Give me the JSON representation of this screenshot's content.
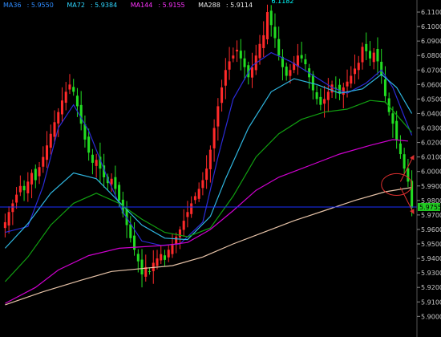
{
  "colors": {
    "background": "#000000",
    "up": "#ff2a2a",
    "down": "#22dd22",
    "ma36": "#2b2bd6",
    "ma72": "#2fb6e0",
    "ma144": "#11a011",
    "ma288": "#d000d0",
    "ma576": "#e7c3a8",
    "axis_text": "#c8c8c8",
    "hline": "#1a2fff",
    "annotation": "#e03030",
    "price_tag": "#22cc22"
  },
  "legend": [
    {
      "name": "MA36",
      "value": "5.9550",
      "color": "#2f8cff"
    },
    {
      "name": "MA72",
      "value": "5.9384",
      "color": "#2fd6ff"
    },
    {
      "name": "MA144",
      "value": "5.9155",
      "color": "#ff33ff"
    },
    {
      "name": "MA288",
      "value": "5.9114",
      "color": "#e9e9e9"
    }
  ],
  "high_label": "6.1182",
  "last_price_tag": "5.9755",
  "chart_data": {
    "type": "candlestick",
    "ylim": [
      5.888,
      6.115
    ],
    "yticks": [
      "6.1100",
      "6.1000",
      "6.0900",
      "6.0800",
      "6.0700",
      "6.0600",
      "6.0500",
      "6.0400",
      "6.0300",
      "6.0200",
      "6.0100",
      "6.0000",
      "5.9900",
      "5.9800",
      "5.9700",
      "5.9600",
      "5.9500",
      "5.9400",
      "5.9300",
      "5.9200",
      "5.9100",
      "5.9000"
    ],
    "x_count": 108,
    "horizontal_line": 5.9755,
    "high_point": {
      "x": 69,
      "value": 6.1182
    },
    "closes": [
      5.965,
      5.972,
      5.978,
      5.984,
      5.99,
      5.987,
      5.993,
      5.999,
      5.994,
      6.003,
      6.01,
      6.018,
      6.026,
      6.034,
      6.041,
      6.049,
      6.055,
      6.06,
      6.055,
      6.045,
      6.033,
      6.022,
      6.013,
      6.006,
      6.008,
      6.002,
      5.996,
      5.992,
      5.995,
      5.988,
      5.98,
      5.971,
      5.963,
      5.954,
      5.946,
      5.938,
      5.929,
      5.934,
      5.931,
      5.937,
      5.94,
      5.943,
      5.939,
      5.946,
      5.95,
      5.955,
      5.96,
      5.966,
      5.972,
      5.978,
      5.983,
      5.988,
      5.994,
      6.002,
      6.015,
      6.03,
      6.045,
      6.058,
      6.07,
      6.076,
      6.08,
      6.084,
      6.078,
      6.072,
      6.065,
      6.072,
      6.08,
      6.088,
      6.094,
      6.11,
      6.101,
      6.092,
      6.08,
      6.072,
      6.066,
      6.07,
      6.075,
      6.08,
      6.078,
      6.074,
      6.065,
      6.056,
      6.05,
      6.046,
      6.05,
      6.055,
      6.06,
      6.057,
      6.054,
      6.058,
      6.062,
      6.066,
      6.071,
      6.075,
      6.086,
      6.083,
      6.078,
      6.082,
      6.076,
      6.066,
      6.052,
      6.041,
      6.033,
      6.022,
      6.012,
      6.002,
      5.993,
      5.975
    ],
    "ma_series": [
      {
        "name": "MA36",
        "color": "#2b2bd6",
        "points": [
          [
            0,
            5.958
          ],
          [
            6,
            5.962
          ],
          [
            10,
            5.99
          ],
          [
            14,
            6.03
          ],
          [
            18,
            6.046
          ],
          [
            22,
            6.028
          ],
          [
            27,
            5.995
          ],
          [
            31,
            5.972
          ],
          [
            36,
            5.952
          ],
          [
            41,
            5.949
          ],
          [
            46,
            5.95
          ],
          [
            52,
            5.965
          ],
          [
            56,
            6.01
          ],
          [
            60,
            6.05
          ],
          [
            65,
            6.073
          ],
          [
            70,
            6.082
          ],
          [
            75,
            6.076
          ],
          [
            80,
            6.068
          ],
          [
            86,
            6.058
          ],
          [
            90,
            6.054
          ],
          [
            95,
            6.061
          ],
          [
            99,
            6.07
          ],
          [
            102,
            6.058
          ],
          [
            105,
            6.038
          ],
          [
            107,
            6.025
          ]
        ]
      },
      {
        "name": "MA72",
        "color": "#2fb6e0",
        "points": [
          [
            0,
            5.947
          ],
          [
            6,
            5.964
          ],
          [
            12,
            5.985
          ],
          [
            18,
            5.999
          ],
          [
            24,
            5.995
          ],
          [
            30,
            5.979
          ],
          [
            36,
            5.963
          ],
          [
            42,
            5.954
          ],
          [
            48,
            5.953
          ],
          [
            54,
            5.969
          ],
          [
            58,
            5.995
          ],
          [
            64,
            6.03
          ],
          [
            70,
            6.055
          ],
          [
            76,
            6.064
          ],
          [
            82,
            6.06
          ],
          [
            88,
            6.054
          ],
          [
            94,
            6.057
          ],
          [
            99,
            6.067
          ],
          [
            103,
            6.058
          ],
          [
            107,
            6.04
          ]
        ]
      },
      {
        "name": "MA144",
        "color": "#11a011",
        "points": [
          [
            0,
            5.924
          ],
          [
            6,
            5.941
          ],
          [
            12,
            5.963
          ],
          [
            18,
            5.978
          ],
          [
            24,
            5.985
          ],
          [
            30,
            5.978
          ],
          [
            36,
            5.967
          ],
          [
            42,
            5.958
          ],
          [
            48,
            5.955
          ],
          [
            54,
            5.961
          ],
          [
            60,
            5.983
          ],
          [
            66,
            6.01
          ],
          [
            72,
            6.026
          ],
          [
            78,
            6.036
          ],
          [
            84,
            6.041
          ],
          [
            90,
            6.043
          ],
          [
            96,
            6.049
          ],
          [
            100,
            6.048
          ],
          [
            104,
            6.036
          ],
          [
            107,
            6.027
          ]
        ]
      },
      {
        "name": "MA288",
        "color": "#d000d0",
        "points": [
          [
            0,
            5.909
          ],
          [
            8,
            5.92
          ],
          [
            14,
            5.932
          ],
          [
            22,
            5.942
          ],
          [
            30,
            5.947
          ],
          [
            36,
            5.948
          ],
          [
            42,
            5.949
          ],
          [
            48,
            5.951
          ],
          [
            54,
            5.96
          ],
          [
            60,
            5.973
          ],
          [
            66,
            5.987
          ],
          [
            72,
            5.996
          ],
          [
            80,
            6.004
          ],
          [
            88,
            6.012
          ],
          [
            96,
            6.018
          ],
          [
            102,
            6.022
          ],
          [
            106,
            6.021
          ]
        ]
      },
      {
        "name": "MA576",
        "color": "#e7c3a8",
        "points": [
          [
            0,
            5.908
          ],
          [
            10,
            5.917
          ],
          [
            20,
            5.925
          ],
          [
            28,
            5.931
          ],
          [
            36,
            5.933
          ],
          [
            44,
            5.935
          ],
          [
            52,
            5.941
          ],
          [
            60,
            5.95
          ],
          [
            68,
            5.958
          ],
          [
            76,
            5.966
          ],
          [
            84,
            5.973
          ],
          [
            92,
            5.98
          ],
          [
            100,
            5.986
          ],
          [
            107,
            5.989
          ]
        ]
      }
    ],
    "annotations": [
      {
        "type": "ellipse",
        "cx": 103,
        "cy": 5.991,
        "rx": 4,
        "ry": 0.0075,
        "color": "#e03030"
      },
      {
        "type": "arrow",
        "from": [
          104,
          5.993
        ],
        "to": [
          107.5,
          6.011
        ],
        "color": "#e03030"
      },
      {
        "type": "arrow",
        "from": [
          104,
          5.989
        ],
        "to": [
          107.5,
          5.971
        ],
        "color": "#e03030"
      }
    ]
  }
}
